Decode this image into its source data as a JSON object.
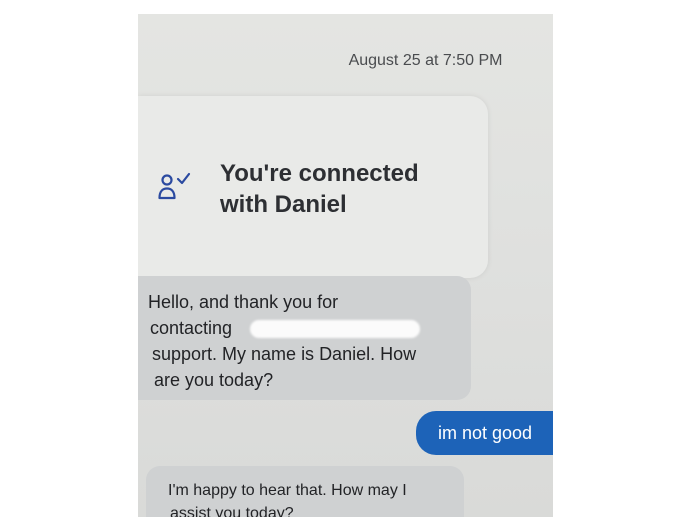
{
  "chat": {
    "timestamp": "August 25 at 7:50 PM",
    "connected": {
      "icon": "person-check-icon",
      "line1": "You're connected",
      "line2": "with Daniel"
    },
    "messages": [
      {
        "sender": "agent",
        "lines": [
          "Hello, and thank you for",
          "contacting",
          "support. My name is Daniel. How",
          "are you today?"
        ]
      },
      {
        "sender": "user",
        "text": "im not good"
      },
      {
        "sender": "agent",
        "lines": [
          "I'm happy to hear that. How may I",
          "assist you today?"
        ]
      }
    ]
  },
  "colors": {
    "user_bubble": "#1d63b8",
    "agent_bubble": "#cfd1d2",
    "background": "#e2e3e1"
  }
}
